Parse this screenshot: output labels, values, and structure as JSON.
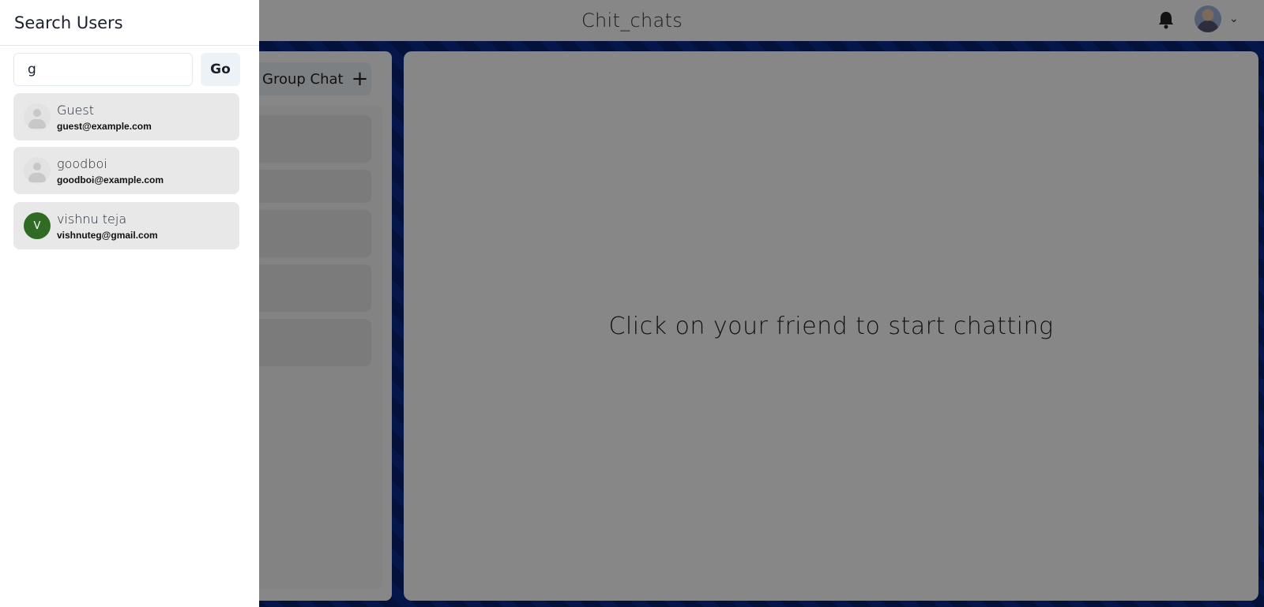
{
  "header": {
    "app_title": "Chit_chats"
  },
  "left_panel": {
    "group_chat_label": "Group Chat",
    "chat_item_count_visible": 5
  },
  "main": {
    "placeholder": "Click on your friend to start chatting"
  },
  "drawer": {
    "title": "Search Users",
    "search_value": "g",
    "go_label": "Go",
    "results": [
      {
        "name": "Guest",
        "email": "guest@example.com",
        "avatar": "default-person-icon"
      },
      {
        "name": "goodboi",
        "email": "goodboi@example.com",
        "avatar": "default-person-icon"
      },
      {
        "name": "vishnu teja",
        "email": "vishnuteg@gmail.com",
        "avatar_initial": "V",
        "avatar_color": "#2f6b22"
      }
    ]
  }
}
